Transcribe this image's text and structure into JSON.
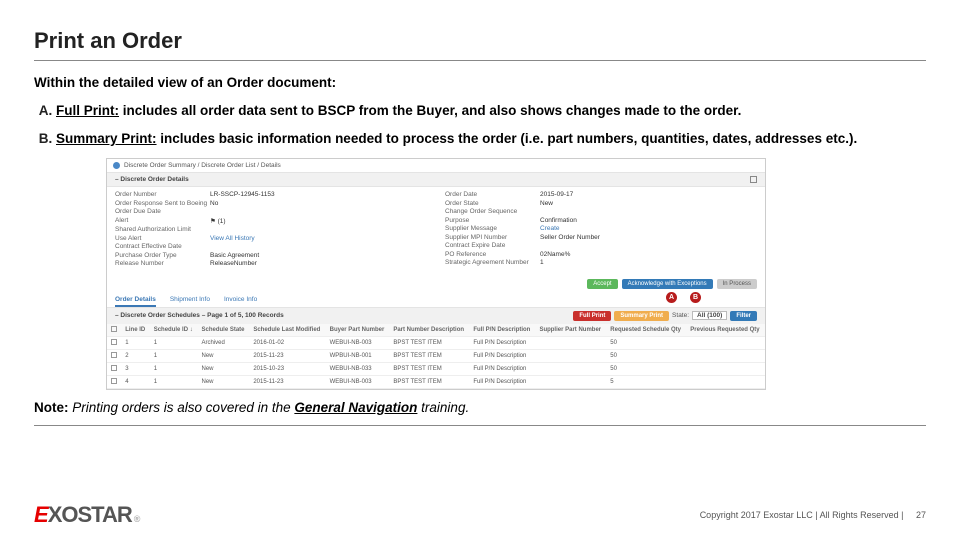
{
  "title": "Print an Order",
  "intro": "Within the detailed view of an Order document:",
  "items": [
    {
      "label": "Full Print:",
      "desc": " includes all order data sent to BSCP from the Buyer, and also shows changes made to the order."
    },
    {
      "label": "Summary Print:",
      "desc": " includes basic information needed to process the order (i.e. part numbers, quantities, dates, addresses etc.)."
    }
  ],
  "note_prefix": "Note:  ",
  "note_body": "Printing orders is also covered in the ",
  "note_bold": "General Navigation",
  "note_tail": " training.",
  "screenshot": {
    "breadcrumb": "Discrete Order Summary / Discrete Order List / Details",
    "section1": "– Discrete Order Details",
    "left": [
      [
        "Order Number",
        "LR-SSCP-12945-1153"
      ],
      [
        "Order Response Sent to Boeing",
        "No"
      ],
      [
        "Order Due Date",
        ""
      ],
      [
        "Alert",
        "⚑ (1)"
      ],
      [
        "Shared Authorization Limit",
        ""
      ],
      [
        "Use Alert",
        "View All History"
      ],
      [
        "Contract Effective Date",
        ""
      ],
      [
        "Purchase Order Type",
        "Basic Agreement"
      ],
      [
        "Release Number",
        "ReleaseNumber"
      ]
    ],
    "right": [
      [
        "Order Date",
        "2015-09-17"
      ],
      [
        "Order State",
        "New"
      ],
      [
        "Change Order Sequence",
        ""
      ],
      [
        "Purpose",
        "Confirmation"
      ],
      [
        "Supplier Message",
        "Create"
      ],
      [
        "Supplier MPI Number",
        "Seller Order Number"
      ],
      [
        "Contract Expire Date",
        ""
      ],
      [
        "PO Reference",
        "02Name%"
      ],
      [
        "Strategic Agreement Number",
        "1"
      ]
    ],
    "buttons": {
      "accept": "Accept",
      "ack": "Acknowledge with Exceptions",
      "inproc": "In Process"
    },
    "tabs": [
      "Order Details",
      "Shipment Info",
      "Invoice Info"
    ],
    "markers": {
      "a": "A",
      "b": "B"
    },
    "section2": "– Discrete Order Schedules – Page 1 of 5, 100 Records",
    "toolbar": {
      "full": "Full Print",
      "summary": "Summary Print",
      "state_lbl": "State:",
      "state_val": "All (100)",
      "filter": "Filter"
    },
    "columns": [
      "",
      "Line ID",
      "Schedule ID ↓",
      "Schedule State",
      "Schedule Last Modified",
      "Buyer Part Number",
      "Part Number Description",
      "Full P/N Description",
      "Supplier Part Number",
      "Requested Schedule Qty",
      "Previous Requested Qty"
    ],
    "rows": [
      [
        "1",
        "1",
        "Archived",
        "2016-01-02",
        "WEBUI-NB-003",
        "BPST TEST ITEM",
        "Full P/N Description",
        "",
        "50",
        ""
      ],
      [
        "2",
        "1",
        "New",
        "2015-11-23",
        "WPBUI-NB-001",
        "BPST TEST ITEM",
        "Full P/N Description",
        "",
        "50",
        ""
      ],
      [
        "3",
        "1",
        "New",
        "2015-10-23",
        "WEBUI-NB-033",
        "BPST TEST ITEM",
        "Full P/N Description",
        "",
        "50",
        ""
      ],
      [
        "4",
        "1",
        "New",
        "2015-11-23",
        "WEBUI-NB-003",
        "BPST TEST ITEM",
        "Full P/N Description",
        "",
        "5",
        ""
      ]
    ]
  },
  "logo": {
    "part1": "E",
    "part2": "XOSTAR",
    "reg": "®"
  },
  "copyright": "Copyright 2017 Exostar LLC | All Rights Reserved |",
  "page_num": "27"
}
